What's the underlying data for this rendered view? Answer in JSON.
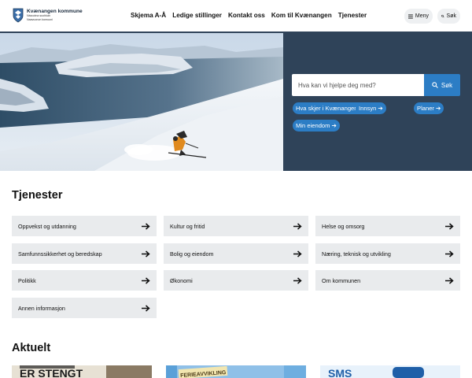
{
  "header": {
    "logo_title": "Kvænangen kommune",
    "logo_sub1": "Návuotna suohkan",
    "logo_sub2": "Naavuonon komuuni",
    "nav": [
      "Skjema A-Å",
      "Ledige stillinger",
      "Kontakt oss",
      "Kom til Kvænangen",
      "Tjenester"
    ],
    "menu_label": "Meny",
    "search_label": "Søk"
  },
  "hero": {
    "search_placeholder": "Hva kan vi hjelpe deg med?",
    "search_button": "Søk",
    "quick_links": [
      "Hva skjer i Kvænangen?",
      "Innsyn",
      "Planer",
      "Min eiendom"
    ]
  },
  "services": {
    "title": "Tjenester",
    "items": [
      "Oppvekst og utdanning",
      "Kultur og fritid",
      "Helse og omsorg",
      "Samfunnssikkerhet og beredskap",
      "Bolig og eiendom",
      "Næring, teknisk og utvikling",
      "Politikk",
      "Økonomi",
      "Om kommunen",
      "Annen informasjon"
    ]
  },
  "news": {
    "title": "Aktuelt",
    "thumb1_text": "ER STENGT",
    "thumb2_text": "FERIEAVVIKLING",
    "thumb3_text": "SMS"
  },
  "colors": {
    "navy": "#2f4359",
    "accent": "#2c7dc5",
    "card_bg": "#e9ebed"
  }
}
